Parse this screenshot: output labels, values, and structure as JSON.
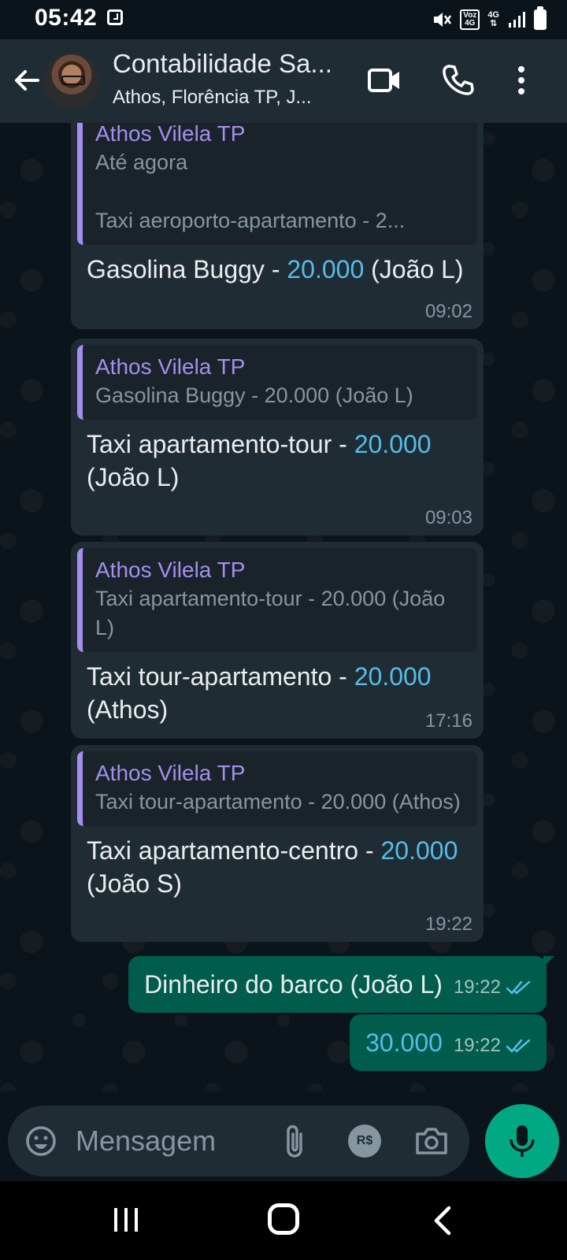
{
  "status_bar": {
    "time": "05:42",
    "voz_label": "Voz",
    "voz_network": "4G",
    "network": "4G"
  },
  "header": {
    "title": "Contabilidade Sa...",
    "subtitle": "Athos, Florência TP, J..."
  },
  "messages": [
    {
      "quote_author": "Athos Vilela TP",
      "quote_lines": [
        "Até agora",
        "",
        "Taxi aeroporto-apartamento - 2..."
      ],
      "text_before": "Gasolina Buggy - ",
      "amount": "20.000",
      "text_after": " (João L)",
      "time": "09:02"
    },
    {
      "quote_author": "Athos Vilela TP",
      "quote_text": "Gasolina Buggy - 20.000 (João L)",
      "text_before": "Taxi apartamento-tour - ",
      "amount": "20.000",
      "text_after": " (João L)",
      "time": "09:03"
    },
    {
      "quote_author": "Athos Vilela TP",
      "quote_text": "Taxi apartamento-tour - 20.000 (João L)",
      "text_before": "Taxi tour-apartamento - ",
      "amount": "20.000",
      "text_after": " (Athos)",
      "time": "17:16"
    },
    {
      "quote_author": "Athos Vilela TP",
      "quote_text": "Taxi tour-apartamento - 20.000 (Athos)",
      "text_before": "Taxi apartamento-centro - ",
      "amount": "20.000",
      "text_after": " (João S)",
      "time": "19:22"
    }
  ],
  "outgoing": [
    {
      "text": "Dinheiro do barco (João L)",
      "time": "19:22",
      "status": "read"
    },
    {
      "text": "30.000",
      "time": "19:22",
      "status": "read"
    }
  ],
  "input": {
    "placeholder": "Mensagem",
    "pix_label": "R$"
  },
  "colors": {
    "background": "#0b141a",
    "header": "#1f2c34",
    "incoming_bubble": "#202c33",
    "outgoing_bubble": "#005c4b",
    "quote_author": "#a58ef0",
    "amount_link": "#53bdeb",
    "read_ticks": "#53bdeb",
    "mic_button": "#00a884"
  },
  "icons": {
    "back": "arrow-left-icon",
    "video": "video-camera-icon",
    "call": "phone-icon",
    "more": "more-vertical-icon",
    "emoji": "emoji-icon",
    "attach": "paperclip-icon",
    "pix": "currency-icon",
    "camera": "camera-icon",
    "mic": "microphone-icon"
  }
}
